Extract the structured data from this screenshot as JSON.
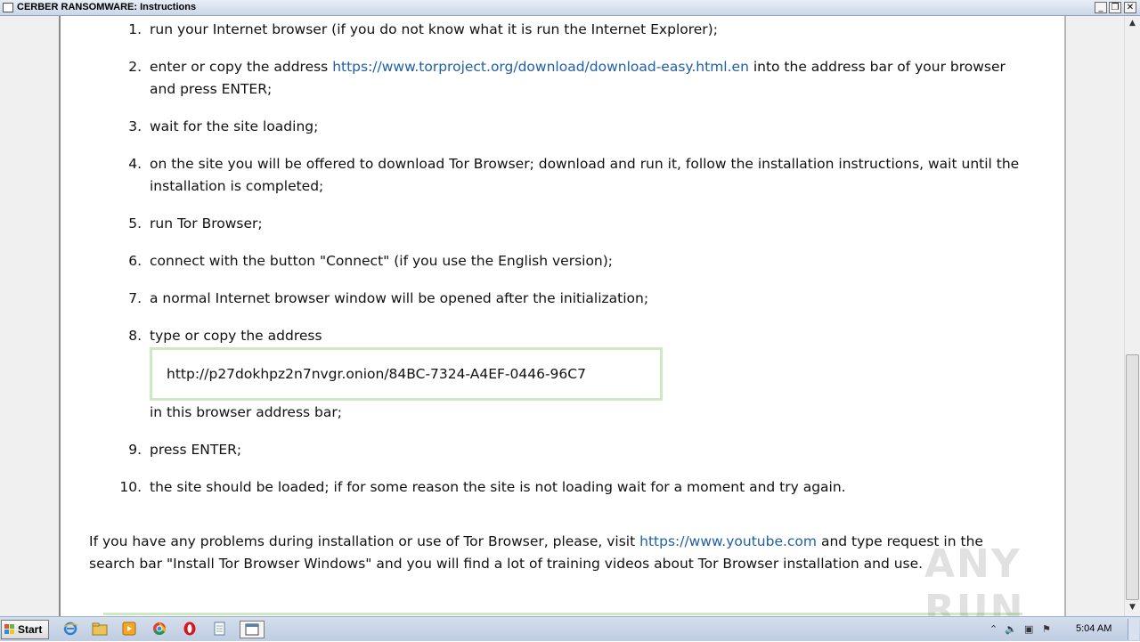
{
  "window": {
    "title": "CERBER RANSOMWARE: Instructions",
    "minimize_glyph": "_",
    "restore_glyph": "❐",
    "close_glyph": "✕"
  },
  "steps": [
    {
      "num": "1.",
      "text": "run your Internet browser (if you do not know what it is run the Internet Explorer);"
    },
    {
      "num": "2.",
      "pre": "enter or copy the address ",
      "link": "https://www.torproject.org/download/download-easy.html.en",
      "post": " into the address bar of your browser and press ENTER;"
    },
    {
      "num": "3.",
      "text": "wait for the site loading;"
    },
    {
      "num": "4.",
      "text": "on the site you will be offered to download Tor Browser; download and run it, follow the installation instructions, wait until the installation is completed;"
    },
    {
      "num": "5.",
      "text": "run Tor Browser;"
    },
    {
      "num": "6.",
      "text": "connect with the button \"Connect\" (if you use the English version);"
    },
    {
      "num": "7.",
      "text": "a normal Internet browser window will be opened after the initialization;"
    },
    {
      "num": "8.",
      "text": "type or copy the address",
      "address": "http://p27dokhpz2n7nvgr.onion/84BC-7324-A4EF-0446-96C7",
      "after": "in this browser address bar;"
    },
    {
      "num": "9.",
      "text": "press ENTER;"
    },
    {
      "num": "10.",
      "text": "the site should be loaded; if for some reason the site is not loading wait for a moment and try again."
    }
  ],
  "help": {
    "pre": "If you have any problems during installation or use of Tor Browser, please, visit ",
    "link": "https://www.youtube.com",
    "post": " and type request in the search bar \"Install Tor Browser Windows\" and you will find a lot of training videos about Tor Browser installation and use."
  },
  "watermark": "ANY RUN",
  "taskbar": {
    "start_label": "Start",
    "clock": "5:04 AM",
    "icons": [
      "internet-explorer-icon",
      "file-explorer-icon",
      "media-player-icon",
      "chrome-icon",
      "opera-icon",
      "notepad-icon",
      "cerber-window-icon"
    ]
  },
  "colors": {
    "link": "#1f5fa6",
    "address_border": "#cfe8c4"
  }
}
